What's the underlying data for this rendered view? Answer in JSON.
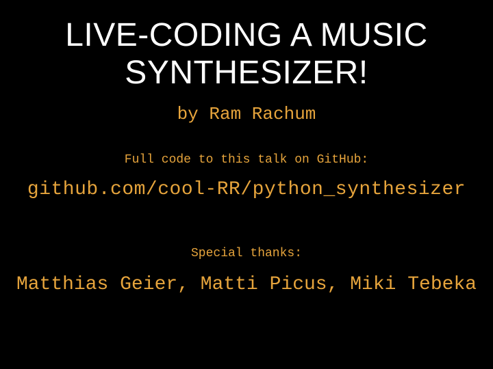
{
  "title": "LIVE-CODING A MUSIC SYNTHESIZER!",
  "author": "by Ram Rachum",
  "code_note": "Full code to this talk on GitHub:",
  "repo": "github.com/cool-RR/python_synthesizer",
  "thanks_label": "Special thanks:",
  "thanks_names": "Matthias Geier, Matti Picus, Miki Tebeka"
}
